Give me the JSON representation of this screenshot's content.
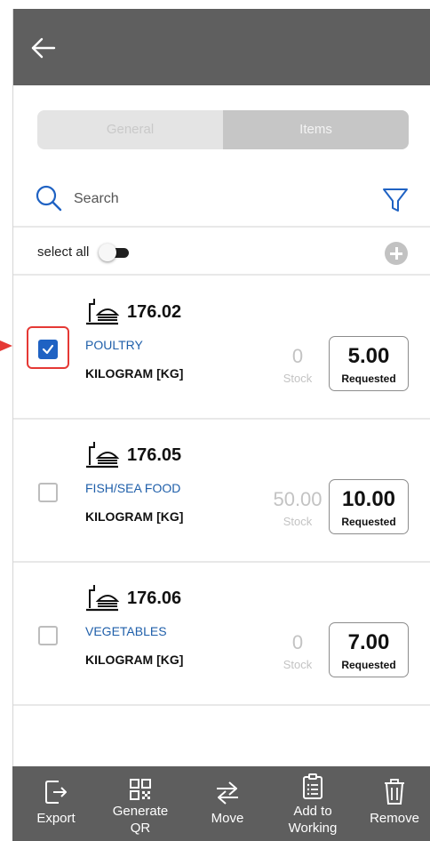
{
  "tabs": {
    "general": "General",
    "items": "Items"
  },
  "search": {
    "placeholder": "Search"
  },
  "select_all": {
    "label": "select all"
  },
  "items": [
    {
      "code": "176.02",
      "category": "POULTRY",
      "unit": "KILOGRAM [KG]",
      "stock": "0",
      "stock_label": "Stock",
      "requested": "5.00",
      "requested_label": "Requested",
      "checked": true
    },
    {
      "code": "176.05",
      "category": "FISH/SEA FOOD",
      "unit": "KILOGRAM [KG]",
      "stock": "50.00",
      "stock_label": "Stock",
      "requested": "10.00",
      "requested_label": "Requested",
      "checked": false
    },
    {
      "code": "176.06",
      "category": "VEGETABLES",
      "unit": "KILOGRAM [KG]",
      "stock": "0",
      "stock_label": "Stock",
      "requested": "7.00",
      "requested_label": "Requested",
      "checked": false
    }
  ],
  "actions": {
    "export": {
      "line1": "Export",
      "line2": ""
    },
    "generate_qr": {
      "line1": "Generate",
      "line2": "QR"
    },
    "move": {
      "line1": "Move",
      "line2": ""
    },
    "add_to_working": {
      "line1": "Add to",
      "line2": "Working"
    },
    "remove": {
      "line1": "Remove",
      "line2": ""
    }
  },
  "colors": {
    "app_bar": "#5f5f5f",
    "bottom_bar": "#5e5e5e",
    "accent_blue": "#1f62c3",
    "category_text": "#1f5faa",
    "highlight_red": "#e53935"
  },
  "icons": {
    "back": "arrow-left-icon",
    "search": "search-icon",
    "filter": "filter-icon",
    "add": "plus-circle-icon",
    "dish": "dish-icon",
    "export": "export-icon",
    "qr": "qr-code-icon",
    "move": "swap-arrows-icon",
    "add_to_working": "clipboard-list-icon",
    "remove": "trash-icon"
  }
}
